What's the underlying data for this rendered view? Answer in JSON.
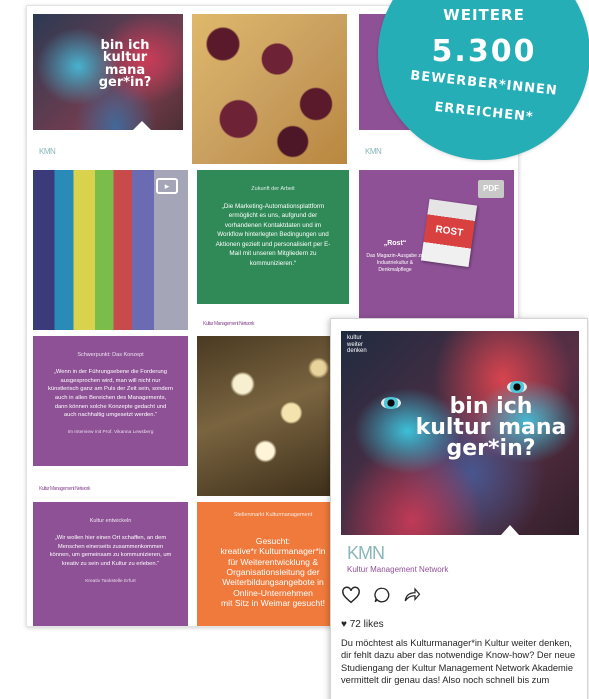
{
  "badge": {
    "line1": "WEITERE",
    "line2": "5.300",
    "line3": "BEWERBER*INNEN",
    "line4": "ERREICHEN*"
  },
  "grid": {
    "tile_face": {
      "small_text": "bin ich kultur mana ger*in?"
    },
    "tile_green": {
      "head": "Zukunft der Arbeit",
      "quote": "„Die Marketing-Automationsplattform ermöglicht es uns, aufgrund der vorhandenen Kontaktdaten und im Workflow hinterlegten Bedingungen und Aktionen gezielt und personalisiert per E-Mail mit unseren Mitgliedern zu kommunizieren.“",
      "brand": "Kultur Management Network"
    },
    "tile_pdf": {
      "icon_label": "PDF",
      "title": "„Rost“",
      "text": "Das Magazin-Ausgabe zu Industriekultur & Denkmalpflege",
      "mag_label": "ROST"
    },
    "tile_purple_quote": {
      "head": "Schwerpunkt: Das Konzept",
      "quote": "„Wenn in der Führungsebene die Forderung ausgesprochen wird, man will nicht nur künstlerisch ganz am Puls der Zeit sein, sondern auch in allen Bereichen des Managements, dann können solche Konzepte gedacht und auch nachhaltig umgesetzt werden.“",
      "sig": "Im Interview mit Prof. Vikanna Lewsberg",
      "brand": "Kultur Management Network"
    },
    "tile_purple_bottom": {
      "head": "Kultur entwickeln",
      "quote": "„Wir wollen hier einen Ort schaffen, an dem Menschen einerseits zusammenkommen können, um gemeinsam zu kommunizieren, um kreativ zu sein und Kultur zu erleben.“",
      "sig": "Kreativ Tankstelle Erfurt"
    },
    "tile_orange": {
      "head": "Stellenmarkt Kulturmanagement",
      "lines": [
        "Gesucht:",
        "kreative*r Kulturmanager*in",
        "für Weiterentwicklung &",
        "Organisationsleitung der",
        "Weiterbildungsangebote in",
        "Online-Unternehmen",
        "mit Sitz in Weimar gesucht!"
      ]
    },
    "logo_mark": "KMN",
    "icons": [
      "camera-icon",
      "pdf-icon",
      "multiple-images-icon"
    ]
  },
  "post": {
    "image": {
      "small_text": "kultur weiter denken",
      "big_text": "bin ich kultur mana ger*in?"
    },
    "logo_mark": "KMN",
    "brand_text": "Kultur Management Network",
    "likes": "72 likes",
    "caption": "Du möchtest als Kulturmanager*in Kultur weiter denken, dir fehlt dazu aber das notwendige Know-how? Der neue Studiengang der Kultur Management Network Akademie vermittelt dir genau das! Also noch schnell bis zum",
    "icons": [
      "heart-icon",
      "comment-icon",
      "share-icon"
    ]
  },
  "colors": {
    "teal": "#25aeb5",
    "purple": "#8e5196",
    "green": "#2f8a57",
    "orange": "#ef7a3c"
  }
}
